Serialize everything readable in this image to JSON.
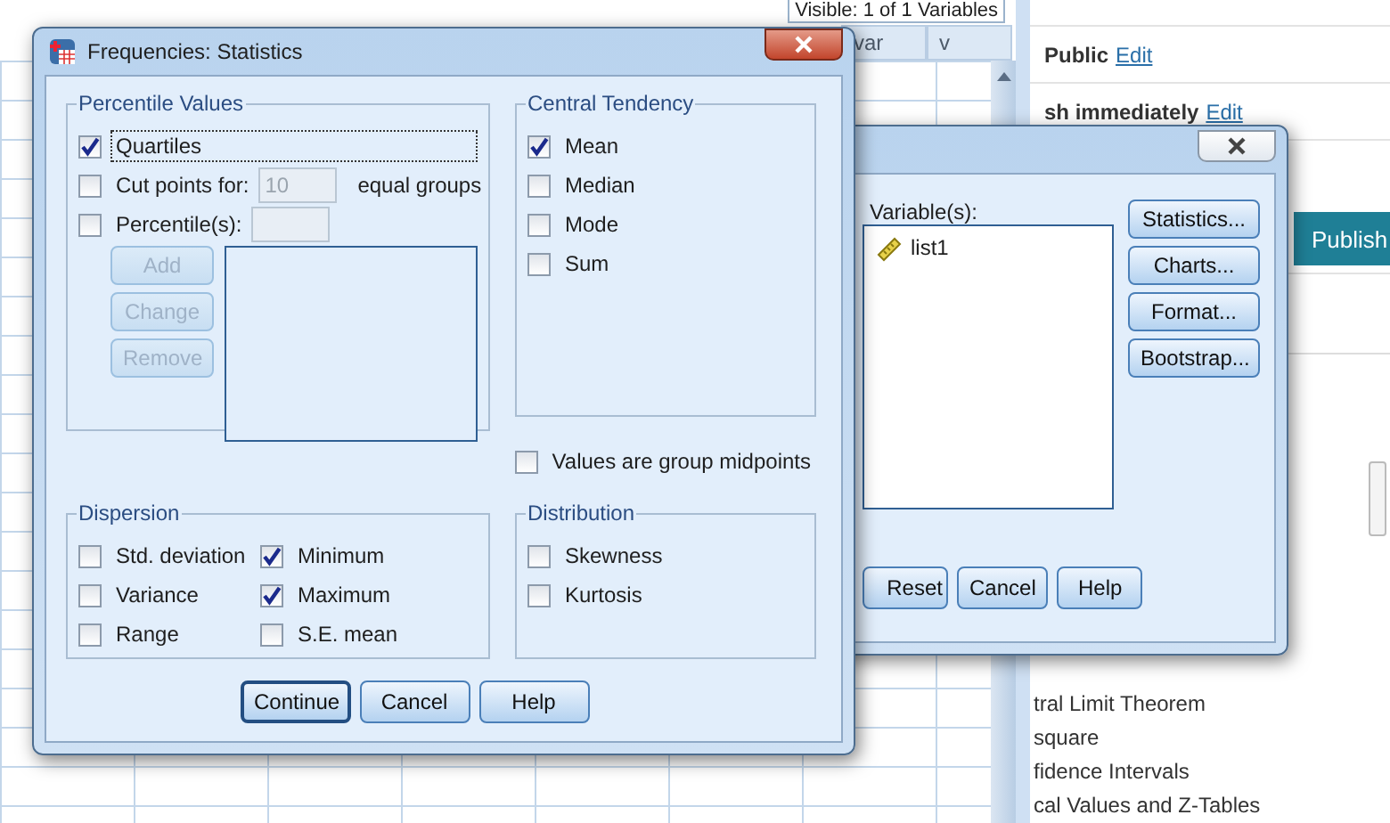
{
  "data_editor": {
    "visible_label": "Visible: 1 of 1 Variables",
    "columns": [
      "var",
      "v"
    ]
  },
  "web_page": {
    "rows": [
      {
        "label": "Public",
        "link": "Edit"
      },
      {
        "label": "sh immediately",
        "link": "Edit"
      }
    ],
    "publish_button": "Publish",
    "links": [
      "tral Limit Theorem",
      "square",
      "fidence Intervals",
      "cal Values and Z-Tables"
    ]
  },
  "frequencies_dialog": {
    "variables_label": "Variable(s):",
    "variables": [
      {
        "name": "list1"
      }
    ],
    "side_buttons": [
      "Statistics...",
      "Charts...",
      "Format...",
      "Bootstrap..."
    ],
    "bottom_buttons": [
      "Reset",
      "Cancel",
      "Help"
    ]
  },
  "statistics_dialog": {
    "title": "Frequencies: Statistics",
    "percentile_values": {
      "title": "Percentile Values",
      "options": [
        {
          "kind": "plain",
          "label": "Quartiles",
          "checked": true,
          "focused": true
        },
        {
          "kind": "field",
          "label": "Cut points for:",
          "checked": false,
          "value": "10",
          "suffix": "equal groups",
          "field_disabled": true
        },
        {
          "kind": "field",
          "label": "Percentile(s):",
          "checked": false,
          "field_disabled": true
        }
      ],
      "buttons": [
        {
          "label": "Add",
          "disabled": true
        },
        {
          "label": "Change",
          "disabled": true
        },
        {
          "label": "Remove",
          "disabled": true
        }
      ]
    },
    "central_tendency": {
      "title": "Central Tendency",
      "options": [
        {
          "label": "Mean",
          "checked": true
        },
        {
          "label": "Median",
          "checked": false
        },
        {
          "label": "Mode",
          "checked": false
        },
        {
          "label": "Sum",
          "checked": false
        }
      ]
    },
    "group_midpoints": {
      "label": "Values are group midpoints",
      "checked": false
    },
    "dispersion": {
      "title": "Dispersion",
      "options": [
        {
          "label": "Std. deviation",
          "checked": false
        },
        {
          "label": "Minimum",
          "checked": true
        },
        {
          "label": "Variance",
          "checked": false
        },
        {
          "label": "Maximum",
          "checked": true
        },
        {
          "label": "Range",
          "checked": false
        },
        {
          "label": "S.E. mean",
          "checked": false
        }
      ]
    },
    "distribution": {
      "title": "Distribution",
      "options": [
        {
          "label": "Skewness",
          "checked": false
        },
        {
          "label": "Kurtosis",
          "checked": false
        }
      ]
    },
    "buttons": [
      {
        "label": "Continue",
        "default": true
      },
      {
        "label": "Cancel",
        "default": false
      },
      {
        "label": "Help",
        "default": false
      }
    ]
  }
}
